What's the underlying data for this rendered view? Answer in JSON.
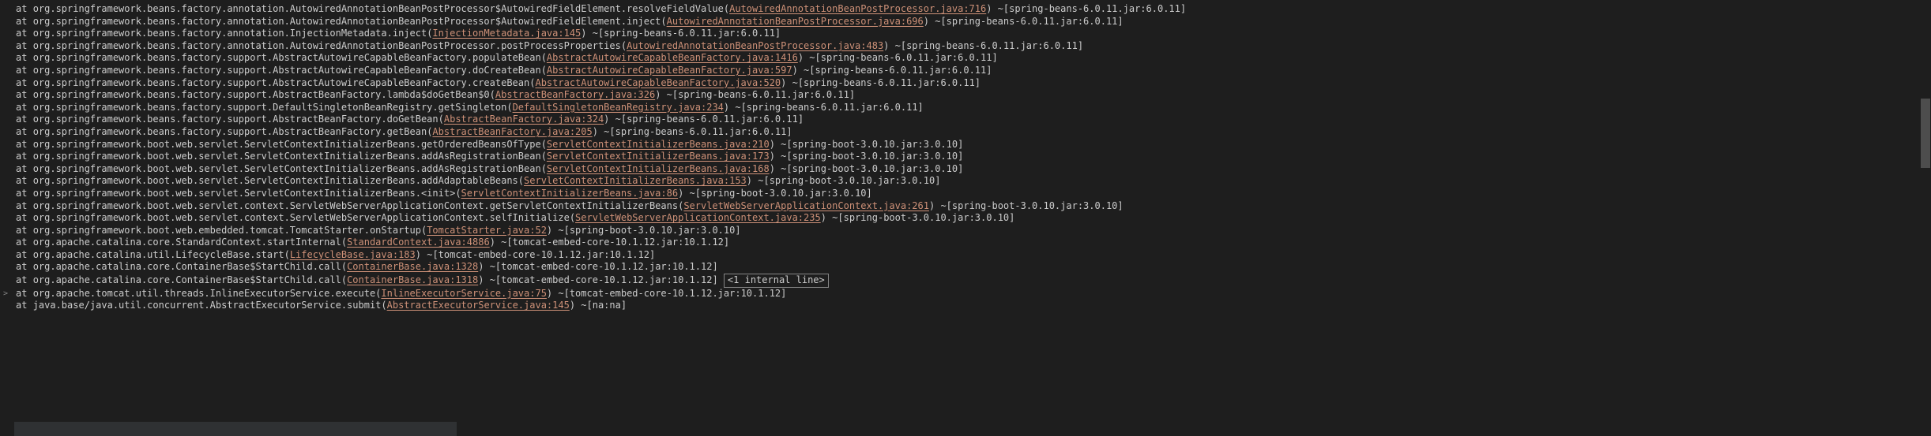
{
  "colors": {
    "background": "#1e1e1e",
    "text": "#cccccc",
    "link": "#ce9178",
    "gutter": "#858585",
    "selection": "#3a3d41",
    "scrollbar": "#4d4d4d"
  },
  "gutter": {
    "expand_arrow_line_index": 23,
    "expand_arrow_glyph": ">"
  },
  "lines": [
    {
      "prefix": "at ",
      "qualified": "org.springframework.beans.factory.annotation.AutowiredAnnotationBeanPostProcessor$AutowiredFieldElement.resolveFieldValue",
      "source": "AutowiredAnnotationBeanPostProcessor.java:716",
      "jar": " ~[spring-beans-6.0.11.jar:6.0.11]"
    },
    {
      "prefix": "at ",
      "qualified": "org.springframework.beans.factory.annotation.AutowiredAnnotationBeanPostProcessor$AutowiredFieldElement.inject",
      "source": "AutowiredAnnotationBeanPostProcessor.java:696",
      "jar": " ~[spring-beans-6.0.11.jar:6.0.11]"
    },
    {
      "prefix": "at ",
      "qualified": "org.springframework.beans.factory.annotation.InjectionMetadata.inject",
      "source": "InjectionMetadata.java:145",
      "jar": " ~[spring-beans-6.0.11.jar:6.0.11]"
    },
    {
      "prefix": "at ",
      "qualified": "org.springframework.beans.factory.annotation.AutowiredAnnotationBeanPostProcessor.postProcessProperties",
      "source": "AutowiredAnnotationBeanPostProcessor.java:483",
      "jar": " ~[spring-beans-6.0.11.jar:6.0.11]"
    },
    {
      "prefix": "at ",
      "qualified": "org.springframework.beans.factory.support.AbstractAutowireCapableBeanFactory.populateBean",
      "source": "AbstractAutowireCapableBeanFactory.java:1416",
      "jar": " ~[spring-beans-6.0.11.jar:6.0.11]"
    },
    {
      "prefix": "at ",
      "qualified": "org.springframework.beans.factory.support.AbstractAutowireCapableBeanFactory.doCreateBean",
      "source": "AbstractAutowireCapableBeanFactory.java:597",
      "jar": " ~[spring-beans-6.0.11.jar:6.0.11]"
    },
    {
      "prefix": "at ",
      "qualified": "org.springframework.beans.factory.support.AbstractAutowireCapableBeanFactory.createBean",
      "source": "AbstractAutowireCapableBeanFactory.java:520",
      "jar": " ~[spring-beans-6.0.11.jar:6.0.11]"
    },
    {
      "prefix": "at ",
      "qualified": "org.springframework.beans.factory.support.AbstractBeanFactory.lambda$doGetBean$0",
      "source": "AbstractBeanFactory.java:326",
      "jar": " ~[spring-beans-6.0.11.jar:6.0.11]"
    },
    {
      "prefix": "at ",
      "qualified": "org.springframework.beans.factory.support.DefaultSingletonBeanRegistry.getSingleton",
      "source": "DefaultSingletonBeanRegistry.java:234",
      "jar": " ~[spring-beans-6.0.11.jar:6.0.11]"
    },
    {
      "prefix": "at ",
      "qualified": "org.springframework.beans.factory.support.AbstractBeanFactory.doGetBean",
      "source": "AbstractBeanFactory.java:324",
      "jar": " ~[spring-beans-6.0.11.jar:6.0.11]"
    },
    {
      "prefix": "at ",
      "qualified": "org.springframework.beans.factory.support.AbstractBeanFactory.getBean",
      "source": "AbstractBeanFactory.java:205",
      "jar": " ~[spring-beans-6.0.11.jar:6.0.11]"
    },
    {
      "prefix": "at ",
      "qualified": "org.springframework.boot.web.servlet.ServletContextInitializerBeans.getOrderedBeansOfType",
      "source": "ServletContextInitializerBeans.java:210",
      "jar": " ~[spring-boot-3.0.10.jar:3.0.10]"
    },
    {
      "prefix": "at ",
      "qualified": "org.springframework.boot.web.servlet.ServletContextInitializerBeans.addAsRegistrationBean",
      "source": "ServletContextInitializerBeans.java:173",
      "jar": " ~[spring-boot-3.0.10.jar:3.0.10]"
    },
    {
      "prefix": "at ",
      "qualified": "org.springframework.boot.web.servlet.ServletContextInitializerBeans.addAsRegistrationBean",
      "source": "ServletContextInitializerBeans.java:168",
      "jar": " ~[spring-boot-3.0.10.jar:3.0.10]"
    },
    {
      "prefix": "at ",
      "qualified": "org.springframework.boot.web.servlet.ServletContextInitializerBeans.addAdaptableBeans",
      "source": "ServletContextInitializerBeans.java:153",
      "jar": " ~[spring-boot-3.0.10.jar:3.0.10]"
    },
    {
      "prefix": "at ",
      "qualified": "org.springframework.boot.web.servlet.ServletContextInitializerBeans.<init>",
      "source": "ServletContextInitializerBeans.java:86",
      "jar": " ~[spring-boot-3.0.10.jar:3.0.10]"
    },
    {
      "prefix": "at ",
      "qualified": "org.springframework.boot.web.servlet.context.ServletWebServerApplicationContext.getServletContextInitializerBeans",
      "source": "ServletWebServerApplicationContext.java:261",
      "jar": " ~[spring-boot-3.0.10.jar:3.0.10]"
    },
    {
      "prefix": "at ",
      "qualified": "org.springframework.boot.web.servlet.context.ServletWebServerApplicationContext.selfInitialize",
      "source": "ServletWebServerApplicationContext.java:235",
      "jar": " ~[spring-boot-3.0.10.jar:3.0.10]"
    },
    {
      "prefix": "at ",
      "qualified": "org.springframework.boot.web.embedded.tomcat.TomcatStarter.onStartup",
      "source": "TomcatStarter.java:52",
      "jar": " ~[spring-boot-3.0.10.jar:3.0.10]"
    },
    {
      "prefix": "at ",
      "qualified": "org.apache.catalina.core.StandardContext.startInternal",
      "source": "StandardContext.java:4886",
      "jar": " ~[tomcat-embed-core-10.1.12.jar:10.1.12]"
    },
    {
      "prefix": "at ",
      "qualified": "org.apache.catalina.util.LifecycleBase.start",
      "source": "LifecycleBase.java:183",
      "jar": " ~[tomcat-embed-core-10.1.12.jar:10.1.12]"
    },
    {
      "prefix": "at ",
      "qualified": "org.apache.catalina.core.ContainerBase$StartChild.call",
      "source": "ContainerBase.java:1328",
      "jar": " ~[tomcat-embed-core-10.1.12.jar:10.1.12]"
    },
    {
      "prefix": "at ",
      "qualified": "org.apache.catalina.core.ContainerBase$StartChild.call",
      "source": "ContainerBase.java:1318",
      "jar": " ~[tomcat-embed-core-10.1.12.jar:10.1.12]",
      "internal": "<1 internal line>"
    },
    {
      "prefix": "at ",
      "qualified": "org.apache.tomcat.util.threads.InlineExecutorService.execute",
      "source": "InlineExecutorService.java:75",
      "jar": " ~[tomcat-embed-core-10.1.12.jar:10.1.12]"
    },
    {
      "prefix": "at ",
      "qualified": "java.base/java.util.concurrent.AbstractExecutorService.submit",
      "source": "AbstractExecutorService.java:145",
      "jar": " ~[na:na]"
    }
  ]
}
